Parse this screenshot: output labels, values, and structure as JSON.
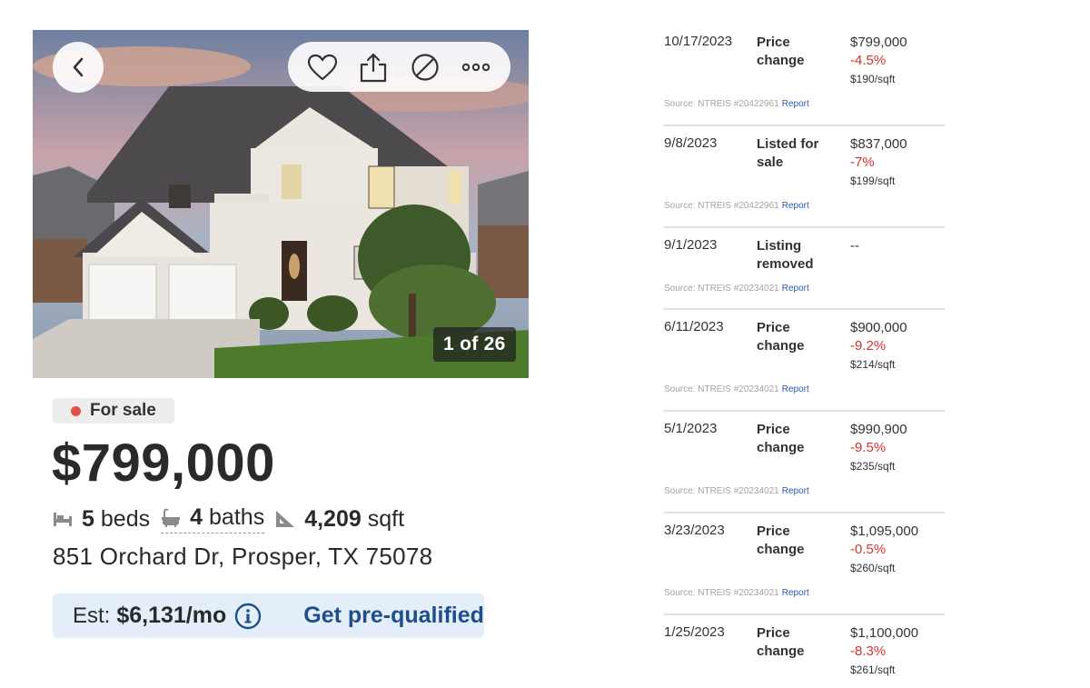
{
  "photo": {
    "counter": "1 of 26",
    "actions": [
      "heart-icon",
      "share-icon",
      "hide-icon",
      "more-icon"
    ]
  },
  "listing": {
    "status": "For sale",
    "status_color": "#e0514b",
    "price": "$799,000",
    "beds_num": "5",
    "beds_label": "beds",
    "baths_num": "4",
    "baths_label": "baths",
    "sqft_num": "4,209",
    "sqft_label": "sqft",
    "address": "851 Orchard Dr, Prosper, TX 75078"
  },
  "estimate": {
    "label": "Est:",
    "value": "$6,131/mo",
    "cta": "Get pre-qualified"
  },
  "history": [
    {
      "date": "10/17/2023",
      "event": "Price change",
      "price": "$799,000",
      "change": "-4.5%",
      "psf": "$190/sqft",
      "source": "Source: NTREIS #20422961",
      "report": "Report"
    },
    {
      "date": "9/8/2023",
      "event": "Listed for sale",
      "price": "$837,000",
      "change": "-7%",
      "psf": "$199/sqft",
      "source": "Source: NTREIS #20422961",
      "report": "Report"
    },
    {
      "date": "9/1/2023",
      "event": "Listing removed",
      "price": "--",
      "change": "",
      "psf": "",
      "source": "Source: NTREIS #20234021",
      "report": "Report"
    },
    {
      "date": "6/11/2023",
      "event": "Price change",
      "price": "$900,000",
      "change": "-9.2%",
      "psf": "$214/sqft",
      "source": "Source: NTREIS #20234021",
      "report": "Report"
    },
    {
      "date": "5/1/2023",
      "event": "Price change",
      "price": "$990,900",
      "change": "-9.5%",
      "psf": "$235/sqft",
      "source": "Source: NTREIS #20234021",
      "report": "Report"
    },
    {
      "date": "3/23/2023",
      "event": "Price change",
      "price": "$1,095,000",
      "change": "-0.5%",
      "psf": "$260/sqft",
      "source": "Source: NTREIS #20234021",
      "report": "Report"
    },
    {
      "date": "1/25/2023",
      "event": "Price change",
      "price": "$1,100,000",
      "change": "-8.3%",
      "psf": "$261/sqft",
      "source": "",
      "report": ""
    }
  ],
  "colors": {
    "accent": "#1f4e8c",
    "negative": "#d6322d",
    "estimate_bg": "#e4eef8"
  }
}
